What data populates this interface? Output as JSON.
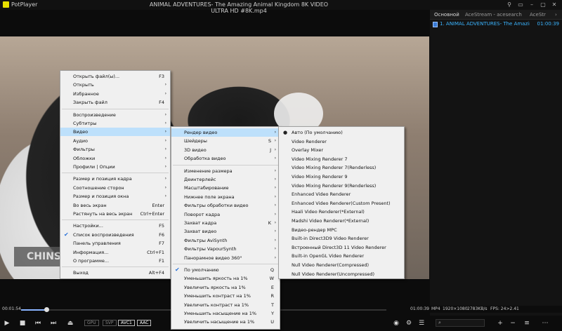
{
  "titlebar": {
    "app": "PotPlayer",
    "title": "ANIMAL ADVENTURES- The Amazing Animal Kingdom 8K VIDEO ULTRA HD #8K.mp4",
    "controls": [
      "⚲",
      "▭",
      "–",
      "▢",
      "✕"
    ]
  },
  "panel": {
    "tabs": [
      "Основной",
      "AceStream - acesearch",
      "AceStr"
    ],
    "more": "›",
    "item": {
      "label": "1. ANIMAL ADVENTURES- The Amazing Anim...",
      "duration": "01:00:39"
    }
  },
  "video": {
    "caption": "CHINS"
  },
  "status": {
    "elapsed": "00:01:54",
    "total": "01:00:39",
    "format": "MP4",
    "resolution": "1920×1080",
    "bitrate": "2783KB/s",
    "fps": "FPS: 24>2.41",
    "progress": 0.07
  },
  "controls": {
    "badges": [
      "GPU",
      "SVP",
      "AVC1",
      "AAC"
    ],
    "icons": [
      "play-icon",
      "stop-icon",
      "prev-icon",
      "next-icon",
      "eject-icon"
    ],
    "right_icons": [
      "camera-icon",
      "gear-icon",
      "menu-icon",
      "add-icon",
      "remove-icon",
      "list-icon",
      "more-icon"
    ]
  },
  "menu_main": [
    {
      "label": "Открыть файл(ы)...",
      "sc": "F3"
    },
    {
      "label": "Открыть",
      "arr": true
    },
    {
      "label": "Избранное",
      "arr": true
    },
    {
      "label": "Закрыть файл",
      "sc": "F4"
    },
    {
      "sep": true
    },
    {
      "label": "Воспроизведение",
      "arr": true
    },
    {
      "label": "Субтитры",
      "arr": true
    },
    {
      "label": "Видео",
      "arr": true,
      "hl": true
    },
    {
      "label": "Аудио",
      "arr": true
    },
    {
      "label": "Фильтры",
      "arr": true
    },
    {
      "label": "Обложки",
      "arr": true
    },
    {
      "label": "Профили | Опции",
      "arr": true
    },
    {
      "sep": true
    },
    {
      "label": "Размер и позиция кадра",
      "arr": true
    },
    {
      "label": "Соотношение сторон",
      "arr": true
    },
    {
      "label": "Размер и позиция окна",
      "arr": true
    },
    {
      "label": "Во весь экран",
      "sc": "Enter"
    },
    {
      "label": "Растянуть на весь экран",
      "sc": "Ctrl+Enter"
    },
    {
      "sep": true
    },
    {
      "label": "Настройки...",
      "sc": "F5"
    },
    {
      "label": "Список воспроизведения",
      "sc": "F6",
      "chk": true
    },
    {
      "label": "Панель управления",
      "sc": "F7"
    },
    {
      "label": "Информация...",
      "sc": "Ctrl+F1"
    },
    {
      "label": "О программе...",
      "sc": "F1"
    },
    {
      "sep": true
    },
    {
      "label": "Выход",
      "sc": "Alt+F4"
    }
  ],
  "menu_video": [
    {
      "label": "Рендер видео",
      "arr": true,
      "hl": true
    },
    {
      "label": "Шейдеры",
      "sc": "S",
      "arr": true
    },
    {
      "label": "3D видео",
      "sc": "J",
      "arr": true
    },
    {
      "label": "Обработка видео",
      "arr": true
    },
    {
      "sep": true
    },
    {
      "label": "Изменение размера",
      "arr": true
    },
    {
      "label": "Деинтерлейс",
      "arr": true
    },
    {
      "label": "Масштабирование",
      "arr": true
    },
    {
      "label": "Нижнее поле экрана",
      "arr": true
    },
    {
      "label": "Фильтры обработки видео",
      "arr": true
    },
    {
      "label": "Поворот кадра",
      "arr": true
    },
    {
      "label": "Захват кадра",
      "sc": "K",
      "arr": true
    },
    {
      "label": "Захват видео",
      "arr": true
    },
    {
      "label": "Фильтры AviSynth",
      "arr": true
    },
    {
      "label": "Фильтры VapourSynth",
      "arr": true
    },
    {
      "label": "Панорамное видео 360°",
      "arr": true
    },
    {
      "sep": true
    },
    {
      "label": "По умолчанию",
      "sc": "Q",
      "chk": true
    },
    {
      "label": "Уменьшить яркость на 1%",
      "sc": "W"
    },
    {
      "label": "Увеличить яркость на 1%",
      "sc": "E"
    },
    {
      "label": "Уменьшить контраст на 1%",
      "sc": "R"
    },
    {
      "label": "Увеличить контраст на 1%",
      "sc": "T"
    },
    {
      "label": "Уменьшить насыщение на 1%",
      "sc": "Y"
    },
    {
      "label": "Увеличить насыщение на 1%",
      "sc": "U"
    }
  ],
  "menu_render": [
    {
      "label": "Авто (По умолчанию)",
      "dot": true
    },
    {
      "label": "Video Renderer"
    },
    {
      "label": "Overlay Mixer"
    },
    {
      "label": "Video Mixing Renderer 7"
    },
    {
      "label": "Video Mixing Renderer 7(Renderless)"
    },
    {
      "label": "Video Mixing Renderer 9"
    },
    {
      "label": "Video Mixing Renderer 9(Renderless)"
    },
    {
      "label": "Enhanced Video Renderer"
    },
    {
      "label": "Enhanced Video Renderer(Custom Present)"
    },
    {
      "label": "Haali Video Renderer(*External)"
    },
    {
      "label": "Madshi Video Renderer(*External)"
    },
    {
      "label": "Видео-рендер MPC"
    },
    {
      "label": "Built-in Direct3D9 Video Renderer"
    },
    {
      "label": "Встроенный Direct3D 11 Video Renderer"
    },
    {
      "label": "Built-in OpenGL Video Renderer"
    },
    {
      "label": "Null Video Renderer(Compressed)"
    },
    {
      "label": "Null Video Renderer(Uncompressed)"
    }
  ]
}
